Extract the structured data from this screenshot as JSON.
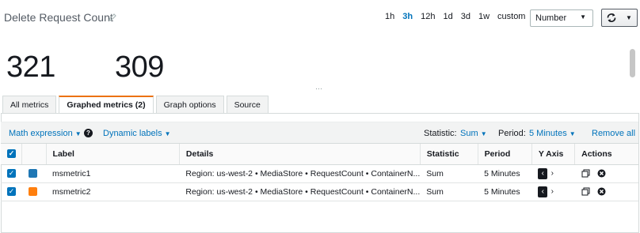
{
  "header": {
    "title": "Delete Request Count",
    "time_ranges": [
      "1h",
      "3h",
      "12h",
      "1d",
      "3d",
      "1w"
    ],
    "active_range": "3h",
    "custom_label": "custom",
    "statistic_select": "Number"
  },
  "values": {
    "v1": "321",
    "v2": "309"
  },
  "tabs": [
    {
      "label": "All metrics"
    },
    {
      "label": "Graphed metrics (2)"
    },
    {
      "label": "Graph options"
    },
    {
      "label": "Source"
    }
  ],
  "toolbar": {
    "math_expression": "Math expression",
    "dynamic_labels": "Dynamic labels",
    "statistic_label": "Statistic:",
    "statistic_value": "Sum",
    "period_label": "Period:",
    "period_value": "5 Minutes",
    "remove_all": "Remove all"
  },
  "table": {
    "headers": {
      "label": "Label",
      "details": "Details",
      "statistic": "Statistic",
      "period": "Period",
      "yaxis": "Y Axis",
      "actions": "Actions"
    },
    "rows": [
      {
        "label": "msmetric1",
        "details": "Region: us-west-2 • MediaStore • RequestCount • ContainerN...",
        "statistic": "Sum",
        "period": "5 Minutes",
        "color": "#1f77b4"
      },
      {
        "label": "msmetric2",
        "details": "Region: us-west-2 • MediaStore • RequestCount • ContainerN...",
        "statistic": "Sum",
        "period": "5 Minutes",
        "color": "#ff7f0e"
      }
    ]
  }
}
